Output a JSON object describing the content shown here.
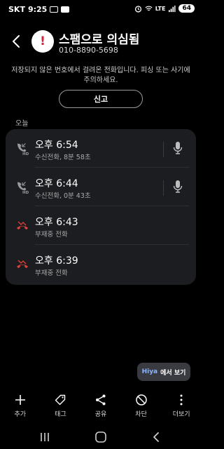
{
  "status_bar": {
    "carrier": "SKT",
    "time": "9:25",
    "network": "LTE",
    "battery": "64"
  },
  "header": {
    "avatar_glyph": "!",
    "title": "스팸으로 의심됨",
    "phone_number": "010-8890-5698"
  },
  "notice": "저장되지 않은 번호에서 걸려온 전화입니다. 피싱 또는 사기에 주의하세요.",
  "report_button": "신고",
  "section_label": "오늘",
  "calls": [
    {
      "time": "오후 6:54",
      "desc": "수신전화, 8분 58초",
      "type": "incoming",
      "icon": "incoming-hd-call-icon",
      "has_recording": true
    },
    {
      "time": "오후 6:44",
      "desc": "수신전화, 0분 43초",
      "type": "incoming",
      "icon": "incoming-hd-call-icon",
      "has_recording": true
    },
    {
      "time": "오후 6:43",
      "desc": "부재중 전화",
      "type": "missed",
      "icon": "missed-call-icon",
      "has_recording": false
    },
    {
      "time": "오후 6:39",
      "desc": "부재중 전화",
      "type": "missed",
      "icon": "missed-call-icon",
      "has_recording": false
    }
  ],
  "view_in": {
    "brand": "Hiya",
    "label": "에서 보기"
  },
  "toolbar": [
    {
      "label": "추가",
      "icon": "plus-icon"
    },
    {
      "label": "태그",
      "icon": "tag-icon"
    },
    {
      "label": "공유",
      "icon": "share-icon"
    },
    {
      "label": "차단",
      "icon": "block-icon"
    },
    {
      "label": "더보기",
      "icon": "more-icon"
    }
  ],
  "colors": {
    "background": "#000000",
    "card": "#1c1d21",
    "missed": "#e0413a",
    "spam_accent": "#d0243b"
  }
}
